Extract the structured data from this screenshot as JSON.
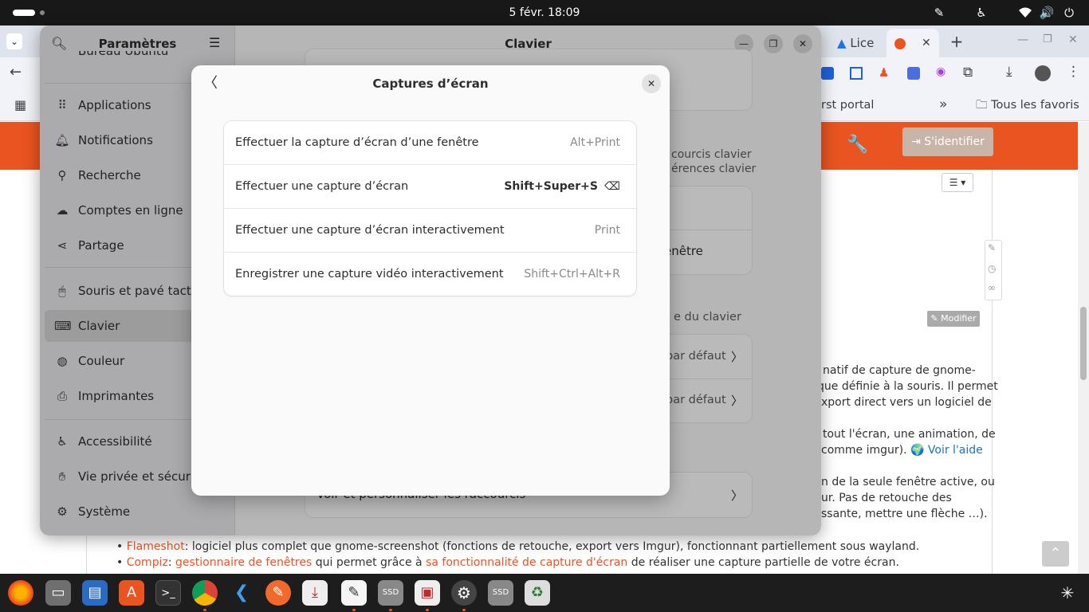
{
  "topbar": {
    "clock": "5 févr.  18:09",
    "tray_icons": [
      "pen-icon",
      "accessibility-icon",
      "wifi-icon",
      "volume-icon",
      "power-icon"
    ]
  },
  "browser": {
    "tabs": [
      {
        "label": "Lice",
        "icon": "drive-icon"
      },
      {
        "label": "",
        "icon": "ubuntu-icon"
      }
    ],
    "new_tab_label": "+",
    "bookmarks": {
      "partial": "rst portal",
      "more": "»",
      "all_bookmarks": "Tous les favoris"
    },
    "login_label": "S'identifier",
    "modify_label": "Modifier",
    "text_lines": [
      "natif de capture de gnome-",
      "que définie à la souris. Il permet",
      "xport direct vers un logiciel de",
      "tout l'écran, une animation, de",
      "comme imgur).",
      "n de la seule fenêtre active, ou",
      "ur. Pas de retouche des",
      "ssante, mettre une flèche …)."
    ],
    "help_link": "Voir l'aide",
    "flameshot_link": "Flameshot",
    "flameshot_text": ": logiciel plus complet que gnome-screenshot (fonctions de retouche, export vers Imgur), fonctionnant partiellement sous wayland.",
    "compiz_link": "Compiz",
    "compiz_sep": ": ",
    "compiz_wm_link": "gestionnaire de fenêtres",
    "compiz_mid": " qui permet grâce à ",
    "compiz_feature_link": "sa fonctionnalité de capture d'écran",
    "compiz_end": " de réaliser une capture partielle de votre écran."
  },
  "settings": {
    "sidebar_title": "Paramètres",
    "partial_item": "Bureau Ubuntu",
    "sidebar_items": [
      {
        "label": "Applications",
        "icon": "apps-grid-icon"
      },
      {
        "label": "Notifications",
        "icon": "bell-icon"
      },
      {
        "label": "Recherche",
        "icon": "search-icon"
      },
      {
        "label": "Comptes en ligne",
        "icon": "cloud-icon"
      },
      {
        "label": "Partage",
        "icon": "share-icon"
      },
      {
        "label": "Souris et pavé tactile",
        "icon": "mouse-icon"
      },
      {
        "label": "Clavier",
        "icon": "keyboard-icon",
        "selected": true
      },
      {
        "label": "Couleur",
        "icon": "color-icon"
      },
      {
        "label": "Imprimantes",
        "icon": "printer-icon"
      },
      {
        "label": "Accessibilité",
        "icon": "accessibility-icon"
      },
      {
        "label": "Vie privée et sécurité",
        "icon": "hand-icon"
      },
      {
        "label": "Système",
        "icon": "gear-icon"
      }
    ],
    "main_title": "Clavier",
    "bg": {
      "shortcuts_line1": "courcis clavier",
      "shortcuts_line2": "érences clavier",
      "window_row": "enêtre",
      "keyboard_section": "e du clavier",
      "default1": "par défaut",
      "default2": "par défaut",
      "customize_row": "Voir et personnaliser les raccourcis"
    }
  },
  "dialog": {
    "title": "Captures d’écran",
    "shortcuts": [
      {
        "name": "Effectuer la capture d’écran d’une fenêtre",
        "accel": "Alt+Print",
        "custom": false
      },
      {
        "name": "Effectuer une capture d’écran",
        "accel": "Shift+Super+S",
        "custom": true
      },
      {
        "name": "Effectuer une capture d’écran interactivement",
        "accel": "Print",
        "custom": false
      },
      {
        "name": "Enregistrer une capture vidéo interactivement",
        "accel": "Shift+Ctrl+Alt+R",
        "custom": false
      }
    ]
  },
  "dock": {
    "apps": [
      "firefox-icon",
      "files-icon",
      "writer-icon",
      "app-center-icon",
      "terminal-icon",
      "chrome-icon",
      "vscode-icon",
      "inkscape-icon",
      "download-icon",
      "text-editor-icon",
      "ssd-icon",
      "screenshot-icon",
      "settings-icon",
      "ssd-icon-2",
      "trash-icon",
      "show-apps-icon"
    ]
  },
  "colors": {
    "accent": "#e95420",
    "sidebar_selected": "#d6d6d8",
    "dialog_bg": "#fafafa"
  }
}
